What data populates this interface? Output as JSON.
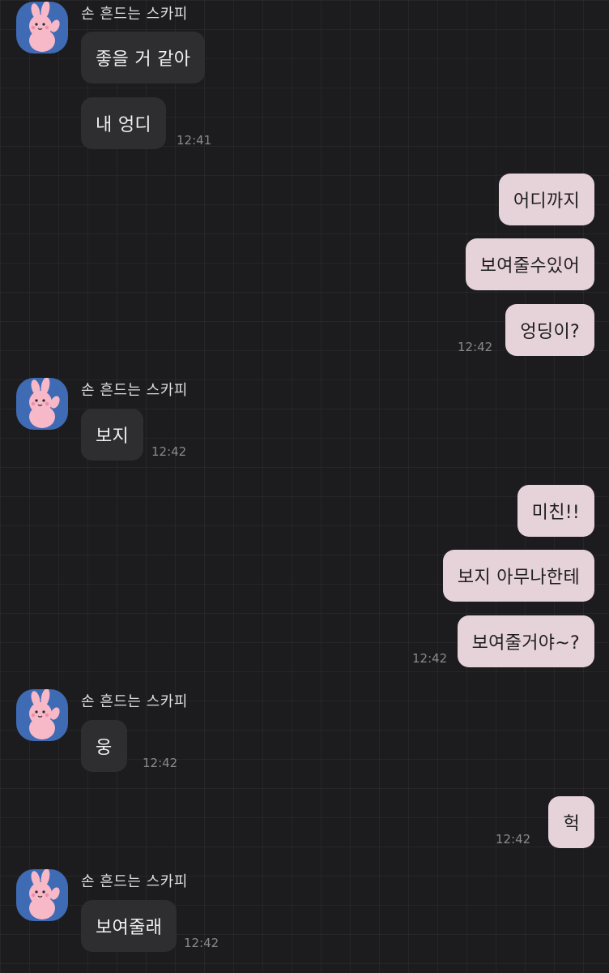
{
  "messages": [
    {
      "from": "other",
      "sender": "손 흔드는 스카피",
      "text": "좋을 거 같아"
    },
    {
      "from": "other",
      "text": "내 엉디",
      "time": "12:41"
    },
    {
      "from": "me",
      "text": "어디까지"
    },
    {
      "from": "me",
      "text": "보여줄수있어"
    },
    {
      "from": "me",
      "text": "엉딩이?",
      "time": "12:42"
    },
    {
      "from": "other",
      "sender": "손 흔드는 스카피",
      "text": "보지",
      "time": "12:42"
    },
    {
      "from": "me",
      "text": "미친!!"
    },
    {
      "from": "me",
      "text": "보지 아무나한테"
    },
    {
      "from": "me",
      "text": "보여줄거야~?",
      "time": "12:42"
    },
    {
      "from": "other",
      "sender": "손 흔드는 스카피",
      "text": "웅",
      "time": "12:42"
    },
    {
      "from": "me",
      "text": "헉",
      "time": "12:42"
    },
    {
      "from": "other",
      "sender": "손 흔드는 스카피",
      "text": "보여줄래",
      "time": "12:42"
    }
  ],
  "colors": {
    "background": "#1c1c1f",
    "incoming_bubble": "#2e2e31",
    "outgoing_bubble": "#e6d2d9",
    "avatar_bg": "#3f6ab4"
  },
  "avatar_icon": "waving-pink-rabbit-icon"
}
